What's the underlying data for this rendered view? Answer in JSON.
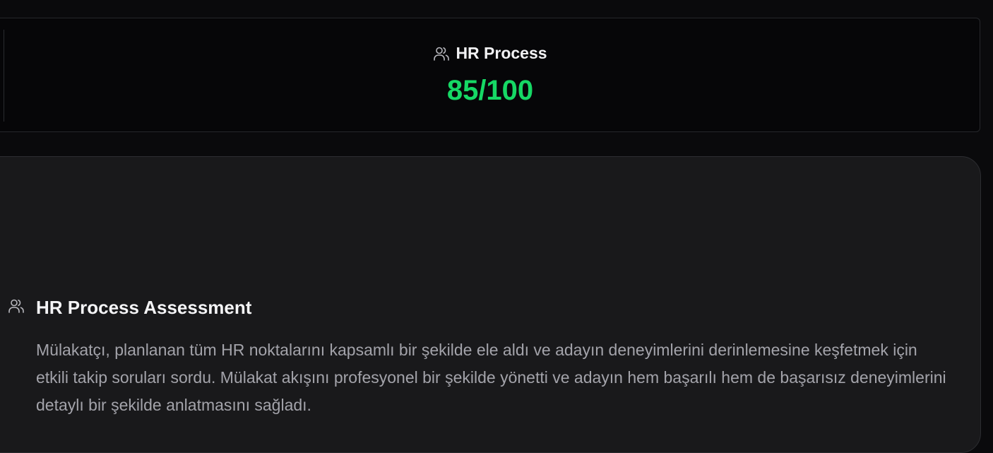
{
  "score_card": {
    "title": "HR Process",
    "score": "85/100",
    "icon": "users-icon",
    "score_color": "#16d865"
  },
  "assessment": {
    "title": "HR Process Assessment",
    "icon": "users-icon",
    "text": "Mülakatçı, planlanan tüm HR noktalarını kapsamlı bir şekilde ele aldı ve adayın deneyimlerini derinlemesine keşfetmek için etkili takip soruları sordu. Mülakat akışını profesyonel bir şekilde yönetti ve adayın hem başarılı hem de başarısız deneyimlerini detaylı bir şekilde anlatmasını sağladı."
  }
}
